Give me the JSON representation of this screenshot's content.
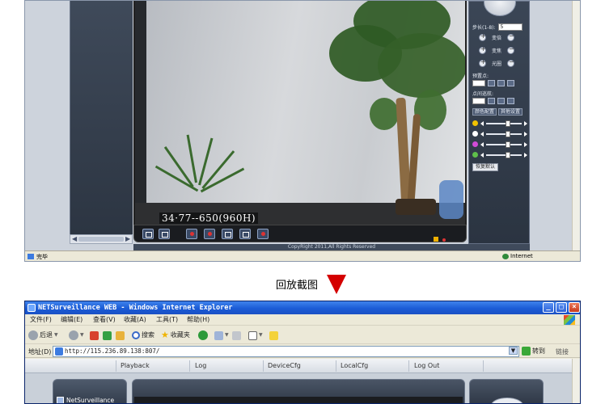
{
  "top_shot": {
    "video_osd": "34·77--650(960H)",
    "copyright": "CopyRight 2011,All Rights Reserved",
    "status_done": "完毕",
    "status_zone": "Internet",
    "ctrl": {
      "step_label": "步长(1-8):",
      "step_value": "5",
      "ptz_rows": [
        {
          "label": "变倍"
        },
        {
          "label": "变焦"
        },
        {
          "label": "光圈"
        }
      ],
      "preset_label": "预置点:",
      "cruise_label": "点间巡航:",
      "tab_color": "颜色配置",
      "tab_other": "其他设置",
      "reset_label": "恢复默认",
      "sliders": [
        {
          "color": "#f2c200",
          "level": 0.62
        },
        {
          "color": "#ffffff",
          "level": 0.62
        },
        {
          "color": "#d24bd6",
          "level": 0.62
        },
        {
          "color": "#5fbf4a",
          "level": 0.62
        }
      ]
    }
  },
  "caption": {
    "text": "回放截图",
    "arrow_color": "#d40000"
  },
  "ie": {
    "title": "NETSurveillance WEB - Windows Internet Explorer",
    "window_buttons": {
      "min": "_",
      "max": "□",
      "close": "×"
    },
    "menu": [
      "文件(F)",
      "编辑(E)",
      "查看(V)",
      "收藏(A)",
      "工具(T)",
      "帮助(H)"
    ],
    "toolbar": {
      "back": "后退",
      "search": "搜索",
      "favorites": "收藏夹"
    },
    "address": {
      "label": "地址(D)",
      "url": "http://115.236.89.138:807/",
      "go": "转到",
      "links": "链接"
    },
    "nav": [
      "Playback",
      "Log",
      "DeviceCfg",
      "LocalCfg",
      "Log Out"
    ],
    "tree_item": "NetSurveillance"
  }
}
